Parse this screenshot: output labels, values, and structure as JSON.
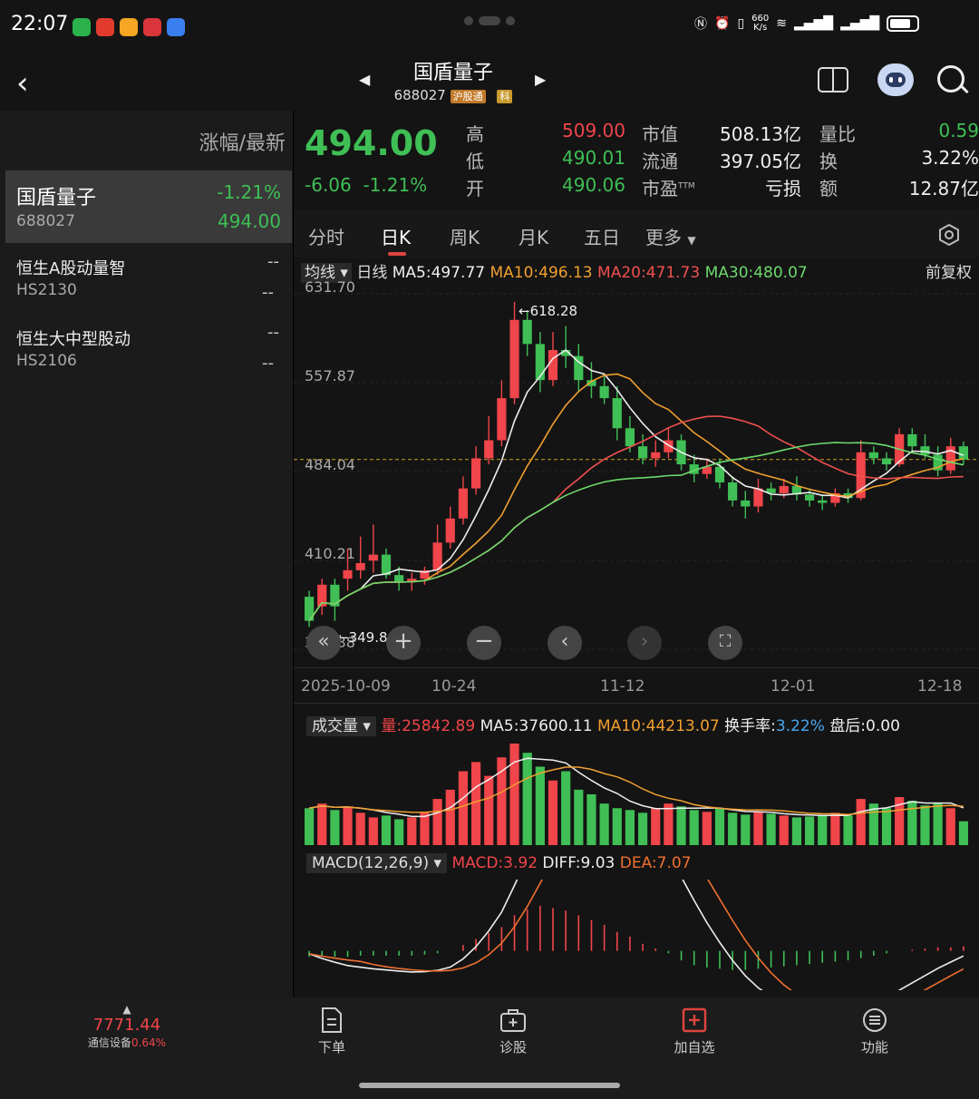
{
  "status": {
    "time": "22:07",
    "net_speed_top": "660",
    "net_speed_unit": "K/s",
    "battery": "72"
  },
  "header": {
    "title": "国盾量子",
    "code": "688027",
    "tag_hgt": "沪股通",
    "tag_ke": "科"
  },
  "left": {
    "heading": "涨幅/最新",
    "items": [
      {
        "name": "国盾量子",
        "code": "688027",
        "change": "-1.21%",
        "price": "494.00",
        "active": true
      },
      {
        "name": "恒生A股动量智",
        "code": "HS2130",
        "change": "--",
        "price": "--"
      },
      {
        "name": "恒生大中型股动",
        "code": "HS2106",
        "change": "--",
        "price": "--"
      }
    ]
  },
  "quote": {
    "price": "494.00",
    "change": "-6.06",
    "change_pct": "-1.21%",
    "high_label": "高",
    "high": "509.00",
    "low_label": "低",
    "low": "490.01",
    "open_label": "开",
    "open": "490.06",
    "mcap_label": "市值",
    "mcap": "508.13亿",
    "float_label": "流通",
    "float": "397.05亿",
    "pe_label": "市盈",
    "pe_sup": "TTM",
    "pe": "亏损",
    "vr_label": "量比",
    "vr": "0.59",
    "turn_label": "换",
    "turn": "3.22%",
    "amt_label": "额",
    "amt": "12.87亿"
  },
  "tabs": [
    "分时",
    "日K",
    "周K",
    "月K",
    "五日",
    "更多"
  ],
  "active_tab": "日K",
  "ma_line": {
    "selector": "均线",
    "period": "日线",
    "ma5": "MA5:497.77",
    "ma10": "MA10:496.13",
    "ma20": "MA20:471.73",
    "ma30": "MA30:480.07",
    "adjust": "前复权"
  },
  "price_axis": [
    "631.70",
    "557.87",
    "484.04",
    "410.21",
    "336.38"
  ],
  "price_annot": {
    "high": "618.28",
    "low": "349.80"
  },
  "date_axis": [
    "2025-10-09",
    "10-24",
    "11-12",
    "12-01",
    "12-18"
  ],
  "volume_line": {
    "selector": "成交量",
    "vol": "量:25842.89",
    "ma5": "MA5:37600.11",
    "ma10": "MA10:44213.07",
    "turnover_label": "换手率:",
    "turnover": "3.22%",
    "after": "盘后:0.00"
  },
  "macd_line": {
    "selector": "MACD(12,26,9)",
    "macd": "MACD:3.92",
    "diff": "DIFF:9.03",
    "dea": "DEA:7.07"
  },
  "bottom": {
    "index_value": "7771.44",
    "index_name": "通信设备",
    "index_change": "0.64%",
    "nav": [
      "下单",
      "诊股",
      "加自选",
      "功能"
    ]
  },
  "colors": {
    "up": "#f0454a",
    "down": "#3fbf55",
    "bg": "#141414",
    "accent": "#e0453f"
  },
  "chart_data": {
    "type": "candlestick",
    "ylim": [
      336.38,
      631.7
    ],
    "x_ticks": [
      "2025-10-09",
      "10-24",
      "11-12",
      "12-01",
      "12-18"
    ],
    "candles": [
      [
        380,
        360,
        385,
        355
      ],
      [
        372,
        390,
        395,
        365
      ],
      [
        390,
        372,
        395,
        360
      ],
      [
        395,
        402,
        420,
        385
      ],
      [
        402,
        408,
        430,
        395
      ],
      [
        410,
        415,
        440,
        400
      ],
      [
        415,
        398,
        420,
        395
      ],
      [
        398,
        392,
        405,
        385
      ],
      [
        392,
        395,
        400,
        385
      ],
      [
        395,
        402,
        405,
        390
      ],
      [
        402,
        425,
        440,
        398
      ],
      [
        425,
        445,
        455,
        420
      ],
      [
        445,
        470,
        480,
        440
      ],
      [
        470,
        495,
        505,
        465
      ],
      [
        495,
        510,
        530,
        490
      ],
      [
        510,
        545,
        560,
        505
      ],
      [
        545,
        610,
        625,
        540
      ],
      [
        610,
        590,
        618,
        580
      ],
      [
        590,
        560,
        600,
        550
      ],
      [
        560,
        585,
        600,
        555
      ],
      [
        585,
        580,
        605,
        570
      ],
      [
        580,
        560,
        590,
        550
      ],
      [
        560,
        555,
        575,
        545
      ],
      [
        555,
        545,
        565,
        540
      ],
      [
        545,
        520,
        555,
        510
      ],
      [
        520,
        505,
        530,
        500
      ],
      [
        505,
        495,
        515,
        490
      ],
      [
        495,
        500,
        510,
        488
      ],
      [
        500,
        510,
        520,
        495
      ],
      [
        510,
        490,
        515,
        485
      ],
      [
        490,
        482,
        498,
        475
      ],
      [
        482,
        488,
        495,
        478
      ],
      [
        488,
        475,
        495,
        470
      ],
      [
        475,
        460,
        480,
        455
      ],
      [
        460,
        455,
        468,
        445
      ],
      [
        455,
        470,
        478,
        450
      ],
      [
        470,
        466,
        475,
        460
      ],
      [
        466,
        472,
        478,
        462
      ],
      [
        472,
        465,
        480,
        460
      ],
      [
        465,
        460,
        470,
        455
      ],
      [
        460,
        458,
        465,
        452
      ],
      [
        458,
        466,
        470,
        455
      ],
      [
        466,
        462,
        470,
        458
      ],
      [
        462,
        500,
        510,
        460
      ],
      [
        500,
        495,
        505,
        490
      ],
      [
        495,
        490,
        500,
        485
      ],
      [
        490,
        515,
        520,
        488
      ],
      [
        515,
        505,
        520,
        500
      ],
      [
        505,
        498,
        515,
        495
      ],
      [
        498,
        485,
        505,
        480
      ],
      [
        485,
        505,
        512,
        482
      ],
      [
        505,
        494,
        509,
        490
      ]
    ],
    "volume_ylim": [
      0,
      110000
    ],
    "volumes": [
      40000,
      45000,
      38000,
      42000,
      35000,
      30000,
      32000,
      28000,
      30000,
      35000,
      50000,
      60000,
      80000,
      90000,
      75000,
      95000,
      110000,
      100000,
      85000,
      70000,
      80000,
      60000,
      55000,
      45000,
      40000,
      38000,
      35000,
      40000,
      45000,
      42000,
      38000,
      36000,
      40000,
      35000,
      33000,
      36000,
      34000,
      32000,
      30000,
      31000,
      33000,
      35000,
      32000,
      50000,
      45000,
      40000,
      52000,
      48000,
      43000,
      45000,
      40000,
      25842.89
    ],
    "macd_ylim": [
      -30,
      60
    ],
    "macd_hist": [
      -5,
      -5,
      -5,
      -5,
      -4,
      -4,
      -4,
      -4,
      -4,
      -3,
      -2,
      0,
      5,
      10,
      15,
      20,
      30,
      35,
      38,
      36,
      34,
      30,
      26,
      22,
      16,
      12,
      6,
      2,
      -2,
      -8,
      -12,
      -14,
      -15,
      -16,
      -16,
      -15,
      -14,
      -13,
      -12,
      -11,
      -10,
      -9,
      -8,
      -6,
      -4,
      -2,
      0,
      1,
      2,
      3,
      3,
      3.92
    ]
  }
}
